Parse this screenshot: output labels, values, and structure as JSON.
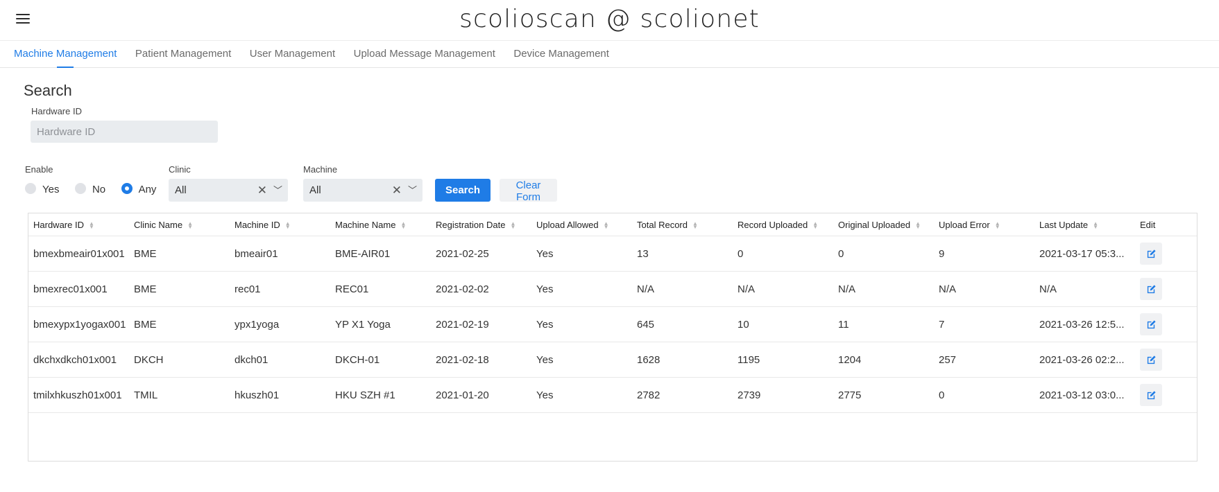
{
  "app": {
    "title": "scolioscan @ scolionet"
  },
  "nav": {
    "tabs": [
      {
        "label": "Machine Management",
        "active": true
      },
      {
        "label": "Patient Management"
      },
      {
        "label": "User Management"
      },
      {
        "label": "Upload Message Management"
      },
      {
        "label": "Device Management"
      }
    ]
  },
  "search": {
    "heading": "Search",
    "hardware_id_label": "Hardware ID",
    "hardware_id_placeholder": "Hardware ID",
    "hardware_id_value": "",
    "enable_label": "Enable",
    "enable_options": [
      "Yes",
      "No",
      "Any"
    ],
    "enable_selected": "Any",
    "clinic_label": "Clinic",
    "clinic_value": "All",
    "machine_label": "Machine",
    "machine_value": "All",
    "search_button": "Search",
    "clear_button": "Clear Form"
  },
  "icons": {
    "menu": "hamburger-menu-icon",
    "clear": "close-icon",
    "dropdown": "chevron-down-icon",
    "sort": "sort-icon",
    "edit": "edit-icon"
  },
  "colors": {
    "accent": "#1f7ce6",
    "input_bg": "#e9ecef"
  },
  "table": {
    "columns": [
      "Hardware ID",
      "Clinic Name",
      "Machine ID",
      "Machine Name",
      "Registration Date",
      "Upload Allowed",
      "Total Record",
      "Record Uploaded",
      "Original Uploaded",
      "Upload Error",
      "Last Update",
      "Edit"
    ],
    "rows": [
      [
        "bmexbmeair01x001",
        "BME",
        "bmeair01",
        "BME-AIR01",
        "2021-02-25",
        "Yes",
        "13",
        "0",
        "0",
        "9",
        "2021-03-17 05:3..."
      ],
      [
        "bmexrec01x001",
        "BME",
        "rec01",
        "REC01",
        "2021-02-02",
        "Yes",
        "N/A",
        "N/A",
        "N/A",
        "N/A",
        "N/A"
      ],
      [
        "bmexypx1yogax001",
        "BME",
        "ypx1yoga",
        "YP X1 Yoga",
        "2021-02-19",
        "Yes",
        "645",
        "10",
        "11",
        "7",
        "2021-03-26 12:5..."
      ],
      [
        "dkchxdkch01x001",
        "DKCH",
        "dkch01",
        "DKCH-01",
        "2021-02-18",
        "Yes",
        "1628",
        "1195",
        "1204",
        "257",
        "2021-03-26 02:2..."
      ],
      [
        "tmilxhkuszh01x001",
        "TMIL",
        "hkuszh01",
        "HKU SZH #1",
        "2021-01-20",
        "Yes",
        "2782",
        "2739",
        "2775",
        "0",
        "2021-03-12 03:0..."
      ]
    ]
  }
}
